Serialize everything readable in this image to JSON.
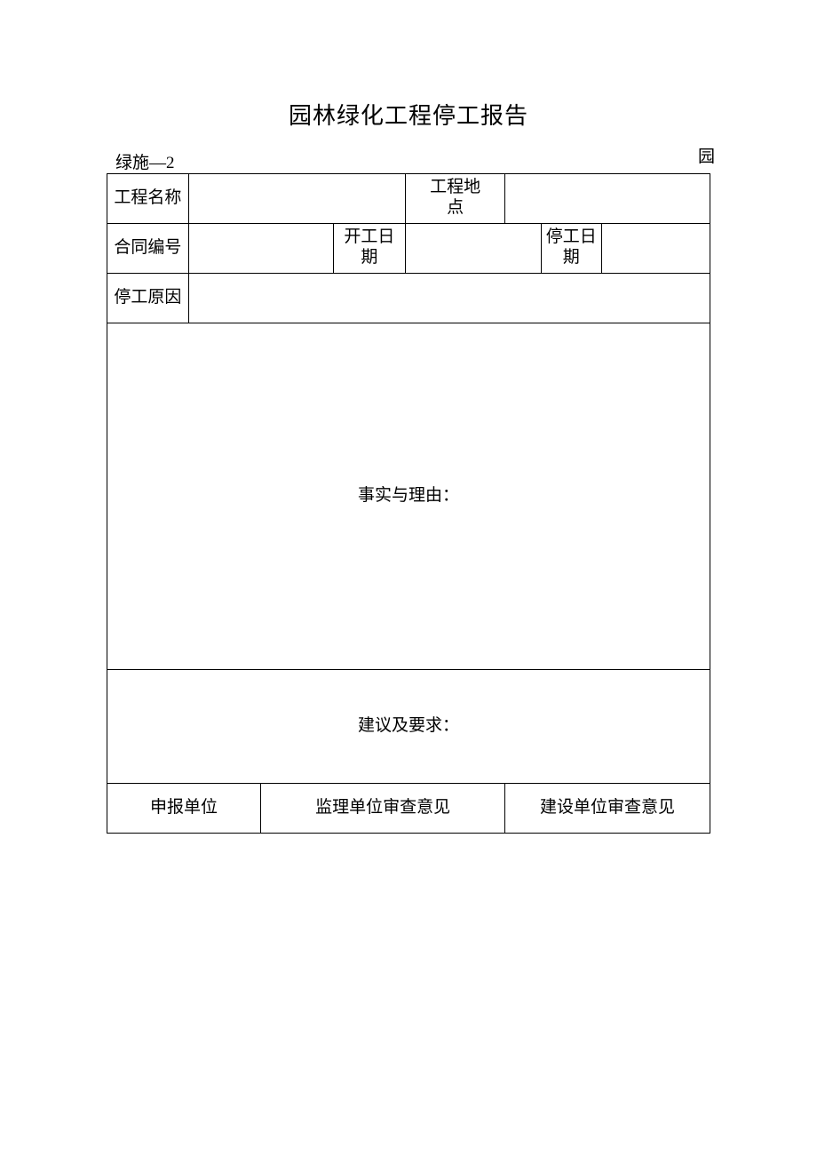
{
  "title": "园林绿化工程停工报告",
  "topRight": "园",
  "formCode": "绿施—2",
  "labels": {
    "projectName": "工程名称",
    "projectLocation": "工程地点",
    "contractNo": "合同编号",
    "startDate": "开工日期",
    "stopDate": "停工日期",
    "stopReason": "停工原因",
    "factsAndReasons": "事实与理由：",
    "suggestions": "建议及要求：",
    "reportingUnit": "申报单位",
    "supervisorOpinion": "监理单位审查意见",
    "ownerOpinion": "建设单位审查意见"
  },
  "values": {
    "projectName": "",
    "projectLocation": "",
    "contractNo": "",
    "startDate": "",
    "stopDate": "",
    "stopReason": "",
    "factsAndReasons": "",
    "suggestions": ""
  }
}
